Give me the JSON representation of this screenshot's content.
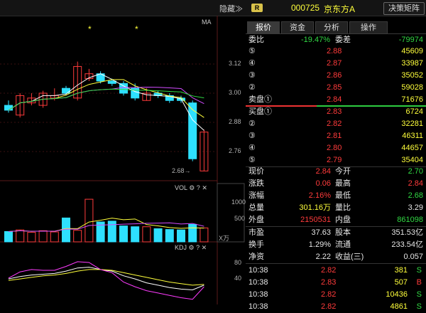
{
  "top": {
    "hide_label": "隐藏≫",
    "badge": "R",
    "code": "000725",
    "name": "京东方A",
    "decision_label": "决策矩阵"
  },
  "chart": {
    "ma_label": "MA",
    "price_ticks": [
      "3.12",
      "3.00",
      "2.88",
      "2.76"
    ],
    "low_label": "2.68",
    "vol_label": "VOL",
    "vol_ticks": [
      "1000",
      "500"
    ],
    "vol_unit": "X万",
    "kdj_label": "KDJ",
    "kdj_ticks": [
      "80",
      "40"
    ],
    "marks": [
      "*",
      "*"
    ]
  },
  "chart_data": {
    "type": "candlestick",
    "price_axis": [
      2.76,
      2.88,
      3.0,
      3.12
    ],
    "low_marker": 2.68,
    "candles": [
      {
        "o": 2.95,
        "c": 2.93,
        "h": 2.97,
        "l": 2.92
      },
      {
        "o": 2.91,
        "c": 2.99,
        "h": 3.0,
        "l": 2.9
      },
      {
        "o": 2.96,
        "c": 2.98,
        "h": 3.0,
        "l": 2.95
      },
      {
        "o": 2.95,
        "c": 3.0,
        "h": 3.01,
        "l": 2.94
      },
      {
        "o": 2.98,
        "c": 2.99,
        "h": 3.02,
        "l": 2.97
      },
      {
        "o": 3.02,
        "c": 3.0,
        "h": 3.03,
        "l": 2.99
      },
      {
        "o": 2.98,
        "c": 3.11,
        "h": 3.13,
        "l": 2.97
      },
      {
        "o": 3.06,
        "c": 3.08,
        "h": 3.1,
        "l": 3.05
      },
      {
        "o": 3.08,
        "c": 3.05,
        "h": 3.09,
        "l": 3.04
      },
      {
        "o": 3.05,
        "c": 3.04,
        "h": 3.06,
        "l": 3.03
      },
      {
        "o": 3.04,
        "c": 3.0,
        "h": 3.05,
        "l": 2.99
      },
      {
        "o": 3.02,
        "c": 2.98,
        "h": 3.04,
        "l": 2.97
      },
      {
        "o": 2.97,
        "c": 3.0,
        "h": 3.02,
        "l": 2.97
      },
      {
        "o": 3.0,
        "c": 2.99,
        "h": 3.01,
        "l": 2.98
      },
      {
        "o": 2.99,
        "c": 2.97,
        "h": 3.0,
        "l": 2.96
      },
      {
        "o": 2.98,
        "c": 2.97,
        "h": 2.99,
        "l": 2.96
      },
      {
        "o": 2.96,
        "c": 2.73,
        "h": 2.97,
        "l": 2.72
      },
      {
        "o": 2.68,
        "c": 2.84,
        "h": 2.85,
        "l": 2.68
      }
    ],
    "volume": [
      260,
      300,
      240,
      280,
      250,
      600,
      290,
      1070,
      500,
      520,
      400,
      380,
      380,
      330,
      310,
      300,
      440,
      350
    ],
    "vol_axis": [
      500,
      1000
    ],
    "kdj_axis": [
      40,
      80
    ],
    "k": [
      38,
      44,
      48,
      50,
      52,
      58,
      66,
      68,
      62,
      58,
      46,
      38,
      28,
      22,
      16,
      12,
      10,
      22
    ],
    "d": [
      34,
      38,
      42,
      46,
      48,
      52,
      58,
      62,
      62,
      60,
      54,
      48,
      42,
      36,
      30,
      26,
      22,
      24
    ],
    "j": [
      40,
      56,
      62,
      60,
      60,
      70,
      82,
      80,
      62,
      54,
      30,
      18,
      8,
      2,
      -4,
      -10,
      -14,
      18
    ]
  },
  "tabs": [
    "报价",
    "资金",
    "分析",
    "操作"
  ],
  "ratio": {
    "label": "委比",
    "value": "-19.47%",
    "diff_label": "委差",
    "diff": "-79974"
  },
  "asks": [
    {
      "label": "⑤",
      "price": "2.88",
      "vol": "45609"
    },
    {
      "label": "④",
      "price": "2.87",
      "vol": "33987"
    },
    {
      "label": "③",
      "price": "2.86",
      "vol": "35052"
    },
    {
      "label": "②",
      "price": "2.85",
      "vol": "59028"
    },
    {
      "label": "卖盘①",
      "price": "2.84",
      "vol": "71676"
    }
  ],
  "bids": [
    {
      "label": "买盘①",
      "price": "2.83",
      "vol": "6724"
    },
    {
      "label": "②",
      "price": "2.82",
      "vol": "32281"
    },
    {
      "label": "③",
      "price": "2.81",
      "vol": "46311"
    },
    {
      "label": "④",
      "price": "2.80",
      "vol": "44657"
    },
    {
      "label": "⑤",
      "price": "2.79",
      "vol": "35404"
    }
  ],
  "stats": [
    {
      "l1": "现价",
      "v1": "2.84",
      "c1": "red",
      "l2": "今开",
      "v2": "2.70",
      "c2": "green"
    },
    {
      "l1": "涨跌",
      "v1": "0.06",
      "c1": "red",
      "l2": "最高",
      "v2": "2.84",
      "c2": "red"
    },
    {
      "l1": "涨幅",
      "v1": "2.16%",
      "c1": "red",
      "l2": "最低",
      "v2": "2.68",
      "c2": "green"
    },
    {
      "l1": "总量",
      "v1": "301.16万",
      "c1": "yellow",
      "l2": "量比",
      "v2": "3.29",
      "c2": "white"
    },
    {
      "l1": "外盘",
      "v1": "2150531",
      "c1": "red",
      "l2": "内盘",
      "v2": "861098",
      "c2": "green"
    }
  ],
  "fin": [
    {
      "l1": "市盈",
      "v1": "37.63",
      "l2": "股本",
      "v2": "351.53亿"
    },
    {
      "l1": "换手",
      "v1": "1.29%",
      "l2": "流通",
      "v2": "233.54亿"
    },
    {
      "l1": "净资",
      "v1": "2.22",
      "l2": "收益(三)",
      "v2": "0.057"
    }
  ],
  "ticks": [
    {
      "time": "10:38",
      "price": "2.82",
      "vol": "381",
      "side": "S"
    },
    {
      "time": "10:38",
      "price": "2.83",
      "vol": "507",
      "side": "B"
    },
    {
      "time": "10:38",
      "price": "2.82",
      "vol": "10436",
      "side": "S"
    },
    {
      "time": "10:38",
      "price": "2.82",
      "vol": "4861",
      "side": "S"
    }
  ],
  "colors": {
    "up": "#ff3b3b",
    "down": "#2ee0ff",
    "bg": "#000000",
    "accent": "#ffff3b"
  }
}
